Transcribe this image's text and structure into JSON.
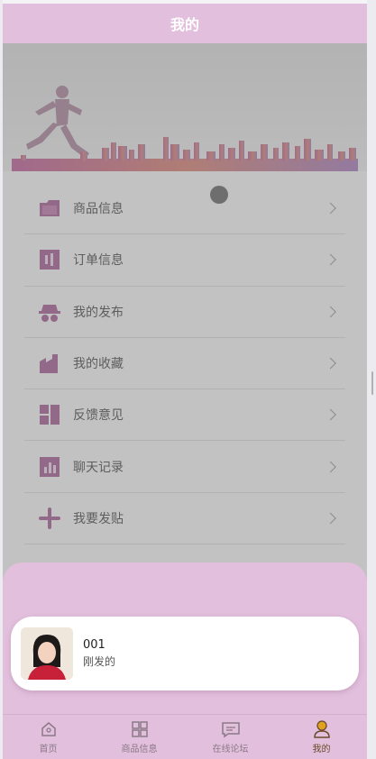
{
  "header": {
    "title": "我的"
  },
  "menu": {
    "items": [
      {
        "label": "商品信息",
        "icon": "folder-icon"
      },
      {
        "label": "订单信息",
        "icon": "order-icon"
      },
      {
        "label": "我的发布",
        "icon": "spy-icon"
      },
      {
        "label": "我的收藏",
        "icon": "factory-icon"
      },
      {
        "label": "反馈意见",
        "icon": "layout-icon"
      },
      {
        "label": "聊天记录",
        "icon": "bar-chart-icon"
      },
      {
        "label": "我要发贴",
        "icon": "plus-icon"
      }
    ]
  },
  "notification": {
    "name": "001",
    "message": "刚发的"
  },
  "tabbar": {
    "items": [
      {
        "label": "首页",
        "icon": "home-icon"
      },
      {
        "label": "商品信息",
        "icon": "grid-icon"
      },
      {
        "label": "在线论坛",
        "icon": "message-icon"
      },
      {
        "label": "我的",
        "icon": "user-icon"
      }
    ],
    "active": "我的"
  },
  "colors": {
    "header": "#e2bfdc",
    "icon": "#9a4a86",
    "active_tab": "#e0a020"
  }
}
